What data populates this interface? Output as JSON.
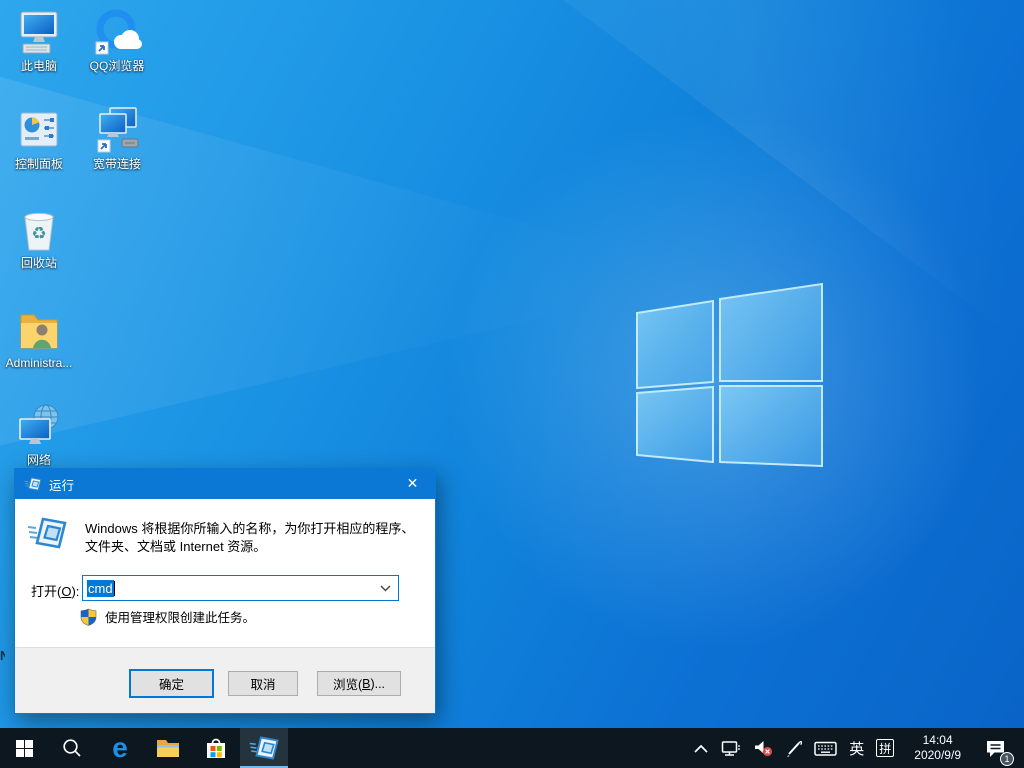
{
  "colors": {
    "accent": "#0078d7",
    "titlebar": "#0a78d4",
    "desktop_top": "#2ea7ed",
    "desktop_bottom": "#0a63c7",
    "taskbar": "#0c1720",
    "selection_bg": "#0078d7",
    "active_underline": "#76b9ed"
  },
  "desktop": {
    "icons": [
      {
        "label": "此电脑"
      },
      {
        "label": "QQ浏览器"
      },
      {
        "label": "控制面板"
      },
      {
        "label": "宽带连接"
      },
      {
        "label": "回收站"
      },
      {
        "label": "Administra..."
      },
      {
        "label": "网络"
      }
    ],
    "obscured_label_fragment": "N"
  },
  "run_dialog": {
    "title": "运行",
    "close_glyph": "✕",
    "description_line1": "Windows 将根据你所输入的名称，为你打开相应的程序、",
    "description_line2": "文件夹、文档或 Internet 资源。",
    "open_prefix": "打开(",
    "open_key": "O",
    "open_suffix": "):",
    "input_value": "cmd",
    "admin_note": "使用管理权限创建此任务。",
    "ok_label": "确定",
    "cancel_label": "取消",
    "browse_prefix": "浏览(",
    "browse_key": "B",
    "browse_suffix": ")..."
  },
  "taskbar": {
    "edge_glyph": "e"
  },
  "tray": {
    "lang": "英",
    "ime": "拼",
    "time": "14:04",
    "date": "2020/9/9",
    "notification_count": "1"
  }
}
